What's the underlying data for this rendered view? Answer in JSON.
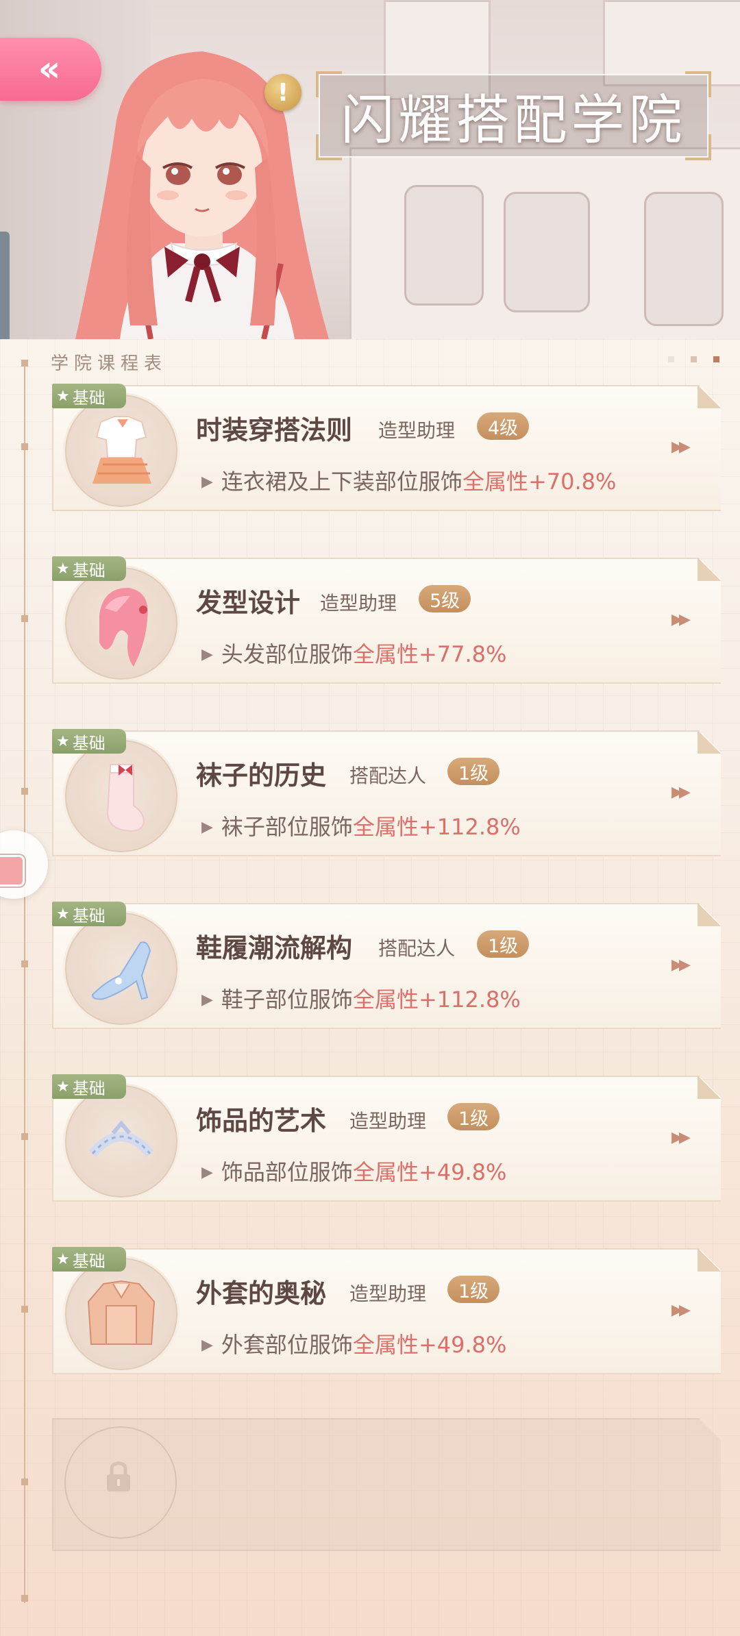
{
  "header": {
    "title": "闪耀搭配学院",
    "back_icon": "double-chevron-left-icon",
    "alert_icon": "!"
  },
  "schedule": {
    "label": "学院课程表"
  },
  "courses": [
    {
      "badge": "基础",
      "title": "时装穿搭法则",
      "role": "造型助理",
      "level": "4级",
      "desc_prefix": "连衣裙及上下装部位服饰",
      "desc_highlight": "全属性+70.8%",
      "icon": "outfit-icon"
    },
    {
      "badge": "基础",
      "title": "发型设计",
      "role": "造型助理",
      "level": "5级",
      "desc_prefix": "头发部位服饰",
      "desc_highlight": "全属性+77.8%",
      "icon": "hair-icon"
    },
    {
      "badge": "基础",
      "title": "袜子的历史",
      "role": "搭配达人",
      "level": "1级",
      "desc_prefix": "袜子部位服饰",
      "desc_highlight": "全属性+112.8%",
      "icon": "sock-icon"
    },
    {
      "badge": "基础",
      "title": "鞋履潮流解构",
      "role": "搭配达人",
      "level": "1级",
      "desc_prefix": "鞋子部位服饰",
      "desc_highlight": "全属性+112.8%",
      "icon": "shoe-icon"
    },
    {
      "badge": "基础",
      "title": "饰品的艺术",
      "role": "造型助理",
      "level": "1级",
      "desc_prefix": "饰品部位服饰",
      "desc_highlight": "全属性+49.8%",
      "icon": "tiara-icon"
    },
    {
      "badge": "基础",
      "title": "外套的奥秘",
      "role": "造型助理",
      "level": "1级",
      "desc_prefix": "外套部位服饰",
      "desc_highlight": "全属性+49.8%",
      "icon": "jacket-icon"
    }
  ],
  "colors": {
    "highlight": "#dc6f69",
    "badge_green": "#8aa06a",
    "level_tan": "#c48f5d",
    "back_pink": "#f76a92"
  }
}
